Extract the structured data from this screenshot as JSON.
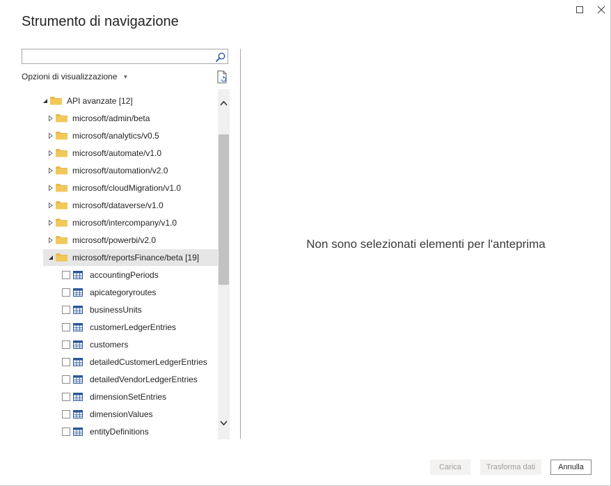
{
  "window": {
    "title": "Strumento di navigazione"
  },
  "search": {
    "value": "",
    "placeholder": ""
  },
  "display_options": {
    "label": "Opzioni di visualizzazione"
  },
  "tree": {
    "root": {
      "label": "API avanzate [12]",
      "expanded": true
    },
    "folders": [
      {
        "label": "microsoft/admin/beta",
        "expanded": false
      },
      {
        "label": "microsoft/analytics/v0.5",
        "expanded": false
      },
      {
        "label": "microsoft/automate/v1.0",
        "expanded": false
      },
      {
        "label": "microsoft/automation/v2.0",
        "expanded": false
      },
      {
        "label": "microsoft/cloudMigration/v1.0",
        "expanded": false
      },
      {
        "label": "microsoft/dataverse/v1.0",
        "expanded": false
      },
      {
        "label": "microsoft/intercompany/v1.0",
        "expanded": false
      },
      {
        "label": "microsoft/powerbi/v2.0",
        "expanded": false
      },
      {
        "label": "microsoft/reportsFinance/beta [19]",
        "expanded": true,
        "selected": true
      }
    ],
    "tables": [
      {
        "label": "accountingPeriods",
        "checked": false
      },
      {
        "label": "apicategoryroutes",
        "checked": false
      },
      {
        "label": "businessUnits",
        "checked": false
      },
      {
        "label": "customerLedgerEntries",
        "checked": false
      },
      {
        "label": "customers",
        "checked": false
      },
      {
        "label": "detailedCustomerLedgerEntries",
        "checked": false
      },
      {
        "label": "detailedVendorLedgerEntries",
        "checked": false
      },
      {
        "label": "dimensionSetEntries",
        "checked": false
      },
      {
        "label": "dimensionValues",
        "checked": false
      },
      {
        "label": "entityDefinitions",
        "checked": false
      }
    ]
  },
  "preview": {
    "message": "Non sono selezionati elementi per l'anteprima"
  },
  "footer": {
    "load_label": "Carica",
    "transform_label": "Trasforma dati",
    "cancel_label": "Annulla"
  },
  "colors": {
    "folder": "#e8b84a",
    "table_icon": "#2b579a",
    "selected_row": "#e6e6e6",
    "disabled_button_bg": "#f3f2f1"
  }
}
